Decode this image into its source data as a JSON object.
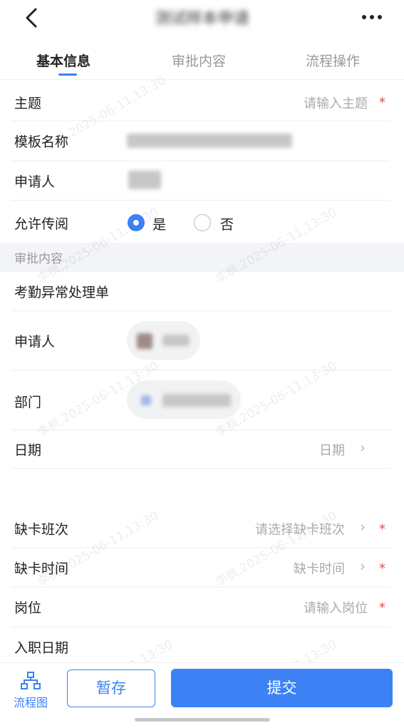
{
  "header": {
    "title": "测试样本申请"
  },
  "tabs": [
    {
      "label": "基本信息",
      "active": true
    },
    {
      "label": "审批内容",
      "active": false
    },
    {
      "label": "流程操作",
      "active": false
    }
  ],
  "basic": {
    "subject_label": "主题",
    "subject_placeholder": "请输入主题",
    "template_label": "模板名称",
    "applicant_label": "申请人",
    "circulate_label": "允许传阅",
    "circulate_yes": "是",
    "circulate_no": "否",
    "circulate_value": "是"
  },
  "section": {
    "title": "审批内容"
  },
  "approval": {
    "form_title": "考勤异常处理单",
    "applicant_label": "申请人",
    "department_label": "部门",
    "date_label": "日期",
    "date_placeholder": "日期",
    "missing_shift_label": "缺卡班次",
    "missing_shift_placeholder": "请选择缺卡班次",
    "missing_time_label": "缺卡时间",
    "missing_time_placeholder": "缺卡时间",
    "position_label": "岗位",
    "position_placeholder": "请输入岗位",
    "hire_date_label": "入职日期"
  },
  "required_mark": "*",
  "bottom": {
    "flow_label": "流程图",
    "save_label": "暂存",
    "submit_label": "提交"
  },
  "watermark": "李枫,2025-06-11,13:30",
  "colors": {
    "accent": "#3b82f6",
    "required": "#e14b4b",
    "section_bg": "#f2f4f7"
  }
}
